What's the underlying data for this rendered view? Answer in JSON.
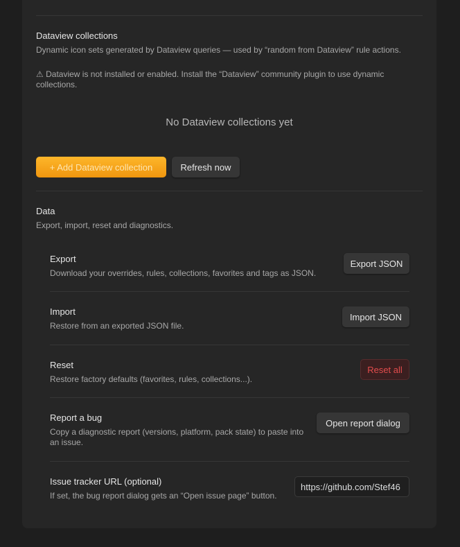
{
  "dataview": {
    "title": "Dataview collections",
    "description": "Dynamic icon sets generated by Dataview queries — used by “random from Dataview” rule actions.",
    "warning_icon": "⚠",
    "warning": "Dataview is not installed or enabled. Install the “Dataview” community plugin to use dynamic collections.",
    "empty": "No Dataview collections yet",
    "add_button": "+ Add Dataview collection",
    "refresh_button": "Refresh now"
  },
  "data_section": {
    "title": "Data",
    "description": "Export, import, reset and diagnostics."
  },
  "rows": {
    "export": {
      "title": "Export",
      "description": "Download your overrides, rules, collections, favorites and tags as JSON.",
      "button": "Export JSON"
    },
    "import": {
      "title": "Import",
      "description": "Restore from an exported JSON file.",
      "button": "Import JSON"
    },
    "reset": {
      "title": "Reset",
      "description": "Restore factory defaults (favorites, rules, collections...).",
      "button": "Reset all"
    },
    "bug": {
      "title": "Report a bug",
      "description": "Copy a diagnostic report (versions, platform, pack state) to paste into an issue.",
      "button": "Open report dialog"
    },
    "tracker": {
      "title": "Issue tracker URL (optional)",
      "description": "If set, the bug report dialog gets an “Open issue page” button.",
      "value": "https://github.com/Stef46"
    }
  },
  "colors": {
    "accent": "#f5a623",
    "danger": "#e14c4c",
    "background": "#1e1e1e",
    "panel": "#262626"
  }
}
